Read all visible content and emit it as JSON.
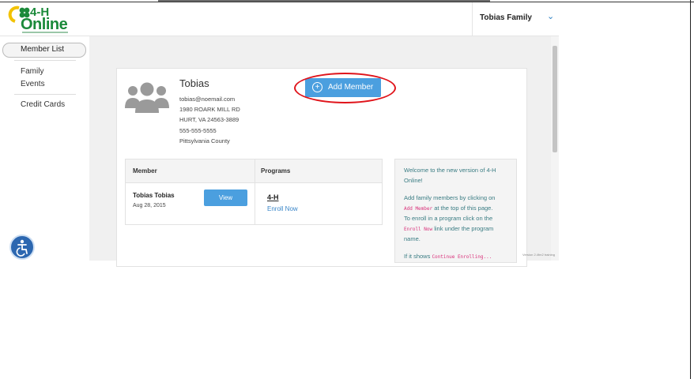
{
  "header": {
    "logo_top": "4-H",
    "logo_bottom": "Online",
    "family_name": "Tobias Family"
  },
  "sidebar": {
    "items": [
      {
        "label": "Member List"
      },
      {
        "label": "Family"
      },
      {
        "label": "Events"
      },
      {
        "label": "Credit Cards"
      }
    ]
  },
  "profile": {
    "name": "Tobias",
    "email": "tobias@noemail.com",
    "address1": "1980 ROARK MILL RD",
    "address2": "HURT, VA 24563-3889",
    "phone": "555-555-5555",
    "county": "Pittsylvania County",
    "add_member_label": "Add Member"
  },
  "table": {
    "columns": [
      "Member",
      "Programs"
    ],
    "rows": [
      {
        "name": "Tobias Tobias",
        "date": "Aug 28, 2015",
        "view_label": "View",
        "program": "4-H",
        "enroll_label": "Enroll Now"
      }
    ]
  },
  "welcome": {
    "line1": "Welcome to the new version of 4-H",
    "line2": "Online!",
    "line3": "Add family members by clicking on",
    "code1": "Add Member",
    "line4b": "at the top of this page.",
    "line5": "To enroll in a program click on the",
    "code2": "Enroll Now",
    "line6b": "link under the program",
    "line7": "name.",
    "line8a": "If it shows",
    "code3": "Continue Enrolling..."
  },
  "corner_note": "Version 2.4fm2 training",
  "colors": {
    "brand_green": "#1b8a3a",
    "accent_blue": "#4b9fdf",
    "highlight_red": "#e0141b"
  },
  "icons": [
    "clover-icon",
    "chevron-down-icon",
    "person-group-icon",
    "plus-circle-icon",
    "accessibility-icon"
  ]
}
